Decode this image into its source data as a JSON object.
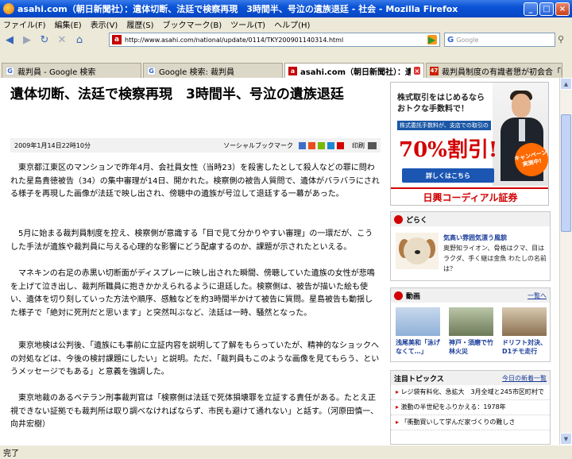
{
  "window": {
    "title": "asahi.com（朝日新聞社）：遺体切断、法廷で検察再現　3時間半、号泣の遺族退廷 - 社会 - Mozilla Firefox"
  },
  "menu": [
    "ファイル(F)",
    "編集(E)",
    "表示(V)",
    "履歴(S)",
    "ブックマーク(B)",
    "ツール(T)",
    "ヘルプ(H)"
  ],
  "nav": {
    "url": "http://www.asahi.com/national/update/0114/TKY200901140314.html",
    "search_placeholder": "Google"
  },
  "tabs": [
    {
      "label": "裁判員 - Google 検索",
      "fav": "G"
    },
    {
      "label": "Google 検索: 裁判員",
      "fav": "G"
    },
    {
      "label": "asahi.com（朝日新聞社）：遺体切...",
      "fav": "a",
      "active": true
    },
    {
      "label": "裁判員制度の有識者懇が初会合「国...",
      "fav": "47"
    }
  ],
  "article": {
    "headline": "遺体切断、法廷で検察再現　3時間半、号泣の遺族退廷",
    "date": "2009年1月14日22時10分",
    "social_label": "ソーシャルブックマーク",
    "print_label": "印刷",
    "paragraphs": [
      "東京都江東区のマンションで昨年4月、会社員女性（当時23）を殺害したとして殺人などの罪に問われた星島貴徳被告（34）の集中審理が14日、開かれた。検察側の被告人質問で、遺体がバラバラにされる様子を再現した画像が法廷で映し出され、傍聴中の遺族が号泣して退廷する一幕があった。",
      "5月に始まる裁判員制度を控え、検察側が意識する「目で見て分かりやすい審理」の一環だが、こうした手法が遺族や裁判員に与える心理的な影響にどう配慮するのか、課題が示されたといえる。",
      "マネキンの右足の赤黒い切断面がディスプレーに映し出された瞬間、傍聴していた遺族の女性が悲鳴を上げて泣き出し、裁判所職員に抱きかかえられるように退廷した。検察側は、被告が描いた絵も使い、遺体を切り刻していった方法や順序、感触などを約3時間半かけて被告に質問。星島被告も動揺した様子で「絶対に死刑だと思います」と突然叫ぶなど、法廷は一時、騒然となった。",
      "東京地検は公判後、「遺族にも事前に立証内容を説明して了解をもらっていたが、精神的なショックへの対処などは、今後の検討課題にしたい」と説明。ただ、「裁判員もこのような画像を見てもらう、というメッセージでもある」と意義を強調した。",
      "東京地裁のあるベテラン刑事裁判官は「検察側は法廷で死体損壊罪を立証する責任がある。たとえ正視できない証拠でも裁判所は取り調べなければならず、市民も避けて通れない」と話す。（河原田慎一、向井宏樹）"
    ]
  },
  "ad": {
    "line1": "株式取引をはじめるなら",
    "line1b": "おトクな手数料で！",
    "line2": "株式委託手数料が、支店での取引の",
    "line3": "70%割引!",
    "button": "詳しくはこちら",
    "badge": "キャンペーン実施中!",
    "brand": "日興コーディアル証券"
  },
  "dog_box": {
    "title": "どらく",
    "text1": "気高い雰囲気漂う風貌",
    "text2": "奥野知ライオン、骨格はクマ、目はラクダ、手く継は金魚 わたしの名前は？"
  },
  "video_box": {
    "title": "動画",
    "more": "一覧へ",
    "items": [
      {
        "caption": "浅尾美和「泳げなくて…」"
      },
      {
        "caption": "神戸・須磨で竹林火災"
      },
      {
        "caption": "ドリフト対決、D1チモ走行"
      }
    ]
  },
  "topics_box": {
    "title": "注目トピックス",
    "more": "今日の新着一覧",
    "items": [
      "レジ袋有料化、急拡大　3月全域と245市区町村で",
      "激動の半世紀をふりかえる：1978年",
      "「衝動買いして学んだ家づくりの難しさ"
    ]
  },
  "status": {
    "text": "完了"
  }
}
